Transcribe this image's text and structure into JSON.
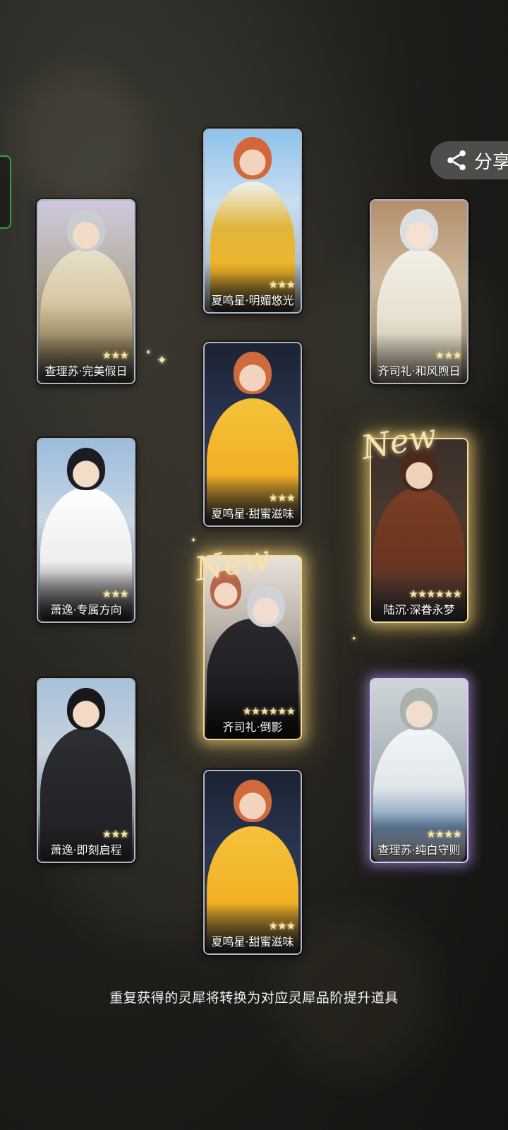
{
  "share": {
    "label": "分享",
    "icon": "share-icon"
  },
  "cards": [
    {
      "name": "夏鸣星·明媚悠光",
      "stars": "★★★",
      "rarity": 3
    },
    {
      "name": "查理苏·完美假日",
      "stars": "★★★",
      "rarity": 3
    },
    {
      "name": "齐司礼·和风煦日",
      "stars": "★★★",
      "rarity": 3
    },
    {
      "name": "夏鸣星·甜蜜滋味",
      "stars": "★★★",
      "rarity": 3
    },
    {
      "name": "萧逸·专属方向",
      "stars": "★★★",
      "rarity": 3
    },
    {
      "name": "陆沉·深眷永梦",
      "stars": "★★★★★★",
      "rarity": 6,
      "new": "New"
    },
    {
      "name": "齐司礼·倒影",
      "stars": "★★★★★★",
      "rarity": 6,
      "new": "New"
    },
    {
      "name": "萧逸·即刻启程",
      "stars": "★★★",
      "rarity": 3
    },
    {
      "name": "查理苏·纯白守则",
      "stars": "★★★★",
      "rarity": 4
    },
    {
      "name": "夏鸣星·甜蜜滋味",
      "stars": "★★★",
      "rarity": 3
    }
  ],
  "footer_note": "重复获得的灵犀将转换为对应灵犀品阶提升道具"
}
